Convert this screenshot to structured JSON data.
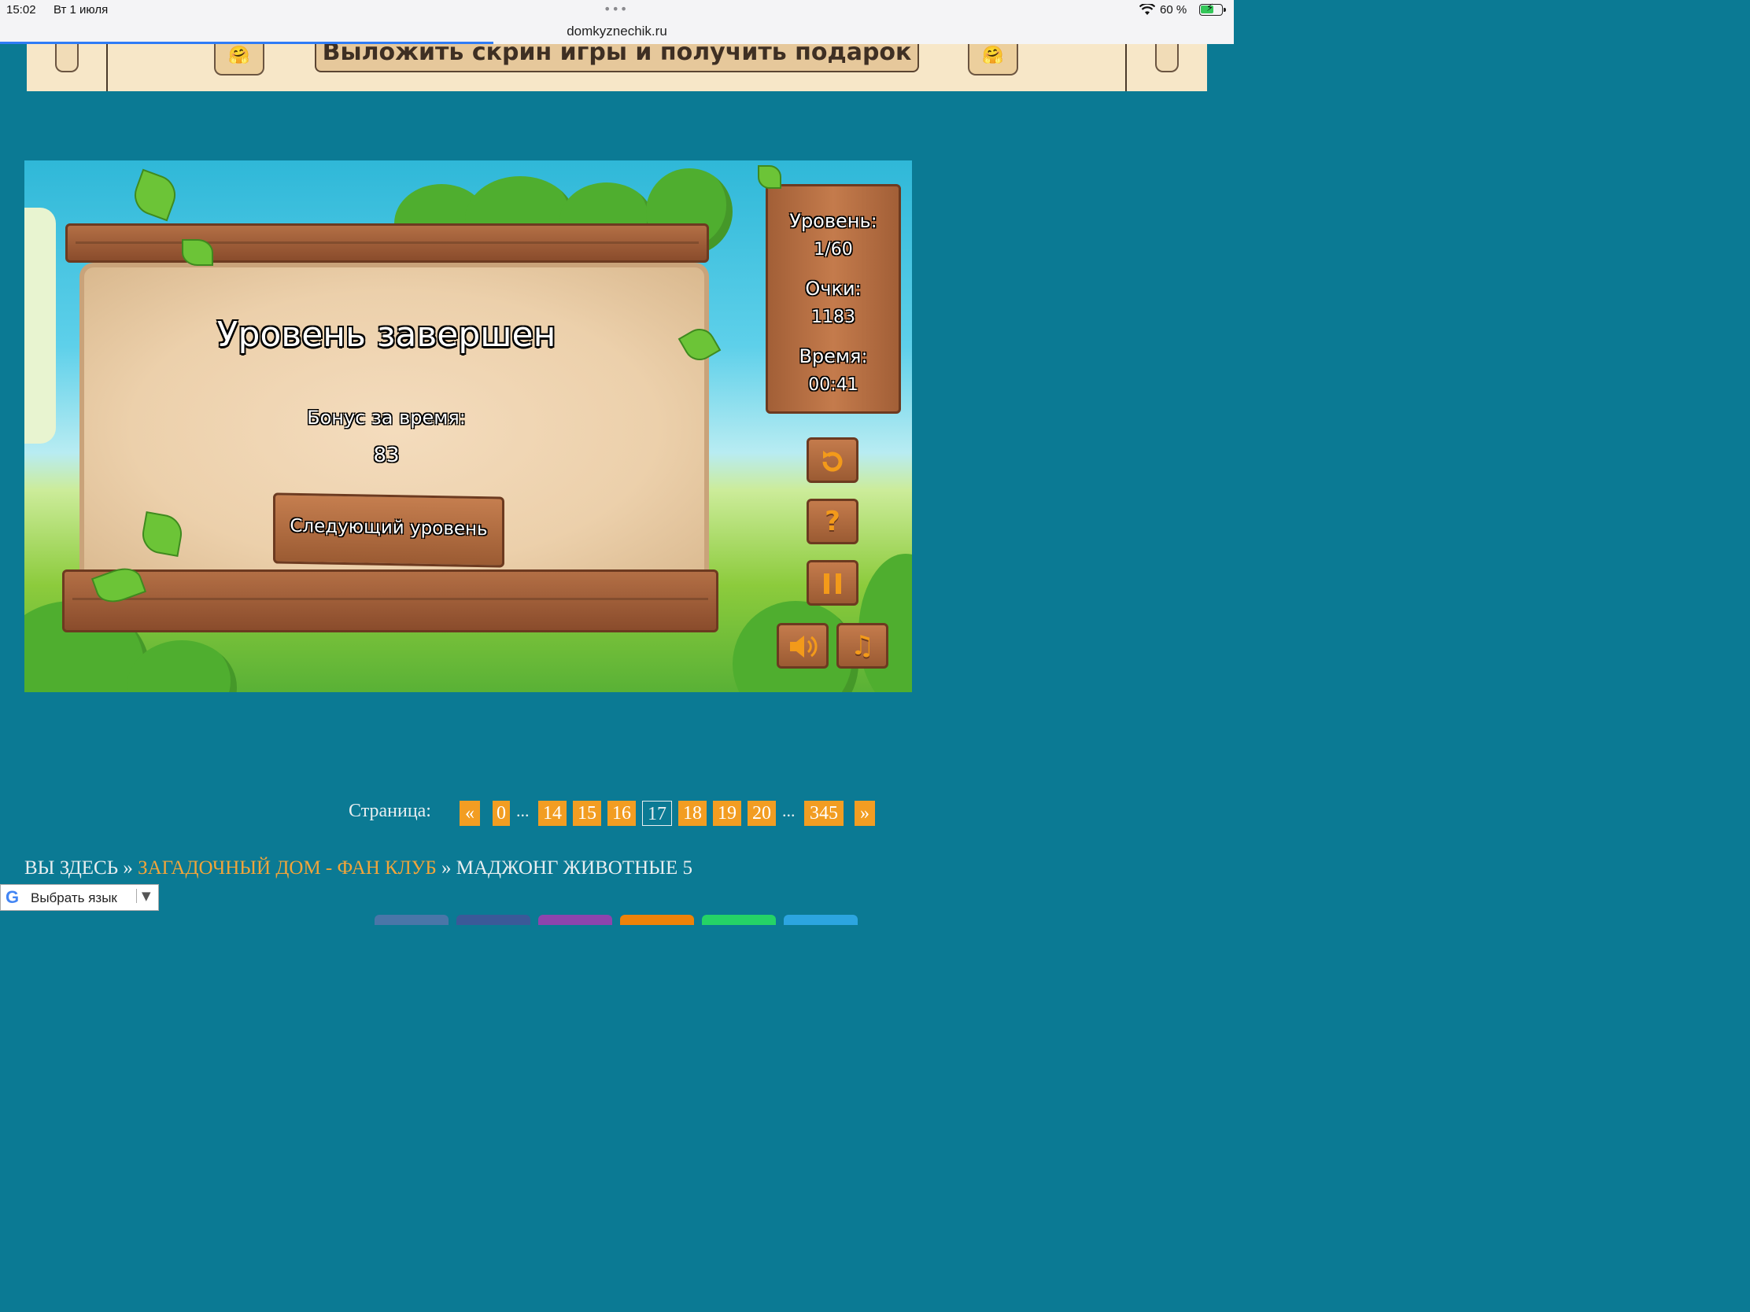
{
  "status_bar": {
    "time": "15:02",
    "date": "Вт 1 июля",
    "battery": "60 %",
    "url": "domkyznechik.ru"
  },
  "banner": {
    "text": "Выложить скрин игры и получить подарок",
    "emoji": "🤗"
  },
  "game": {
    "title": "Уровень завершен",
    "bonus_label": "Бонус за время:",
    "bonus_value": "83",
    "next_button": "Следующий уровень",
    "stats": {
      "level_label": "Уровень:",
      "level_value": "1/60",
      "score_label": "Очки:",
      "score_value": "1183",
      "time_label": "Время:",
      "time_value": "00:41"
    },
    "buttons": {
      "restart_icon": "restart-icon",
      "help_symbol": "?",
      "pause_icon": "pause-icon",
      "sound_icon": "speaker-icon",
      "music_symbol": "♫"
    }
  },
  "pager": {
    "label": "Страница:",
    "prev": "«",
    "next": "»",
    "ellipsis": "...",
    "pages": [
      "0",
      "14",
      "15",
      "16",
      "17",
      "18",
      "19",
      "20",
      "345"
    ],
    "current": "17"
  },
  "breadcrumbs": {
    "you_are_here": "ВЫ ЗДЕСЬ",
    "separator": "»",
    "club": "ЗАГАДОЧНЫЙ ДОМ - ФАН КЛУБ",
    "current": "МАДЖОНГ ЖИВОТНЫЕ 5"
  },
  "translate": {
    "logo": "G",
    "label": "Выбрать язык",
    "arrow": "▼"
  },
  "colors": {
    "page_bg": "#0b7a94",
    "accent": "#f29d22"
  }
}
